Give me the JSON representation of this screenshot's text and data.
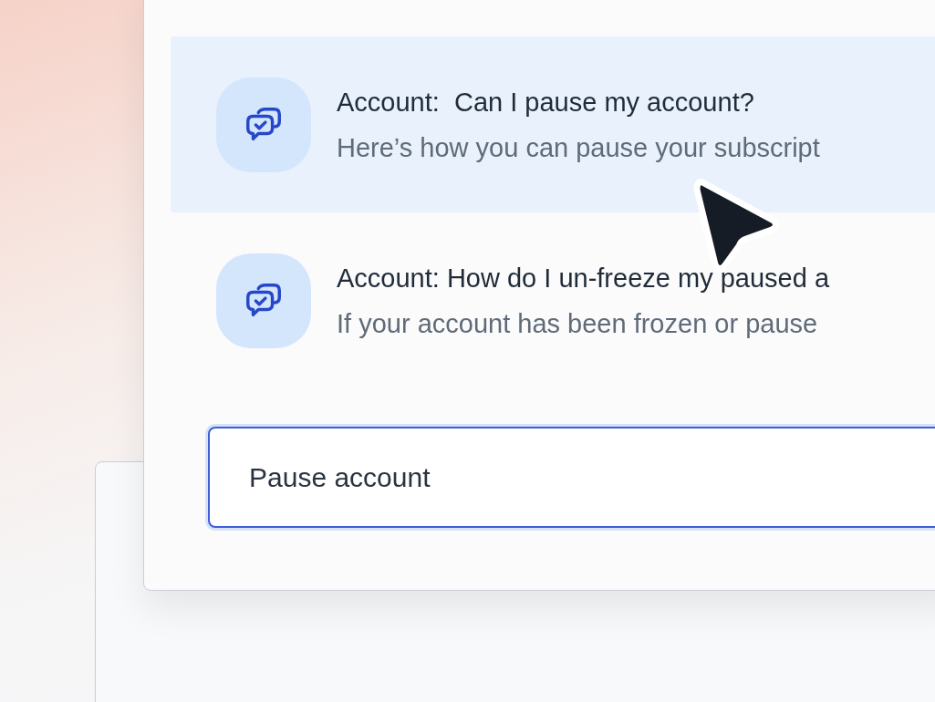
{
  "results": [
    {
      "title": "Account:  Can I pause my account?",
      "snippet": "Here’s how you can pause your subscript",
      "selected": true
    },
    {
      "title": "Account: How do I un-freeze my paused a",
      "snippet": "If your account has been frozen or pause",
      "selected": false
    }
  ],
  "search": {
    "value": "Pause account",
    "focused": true
  }
}
